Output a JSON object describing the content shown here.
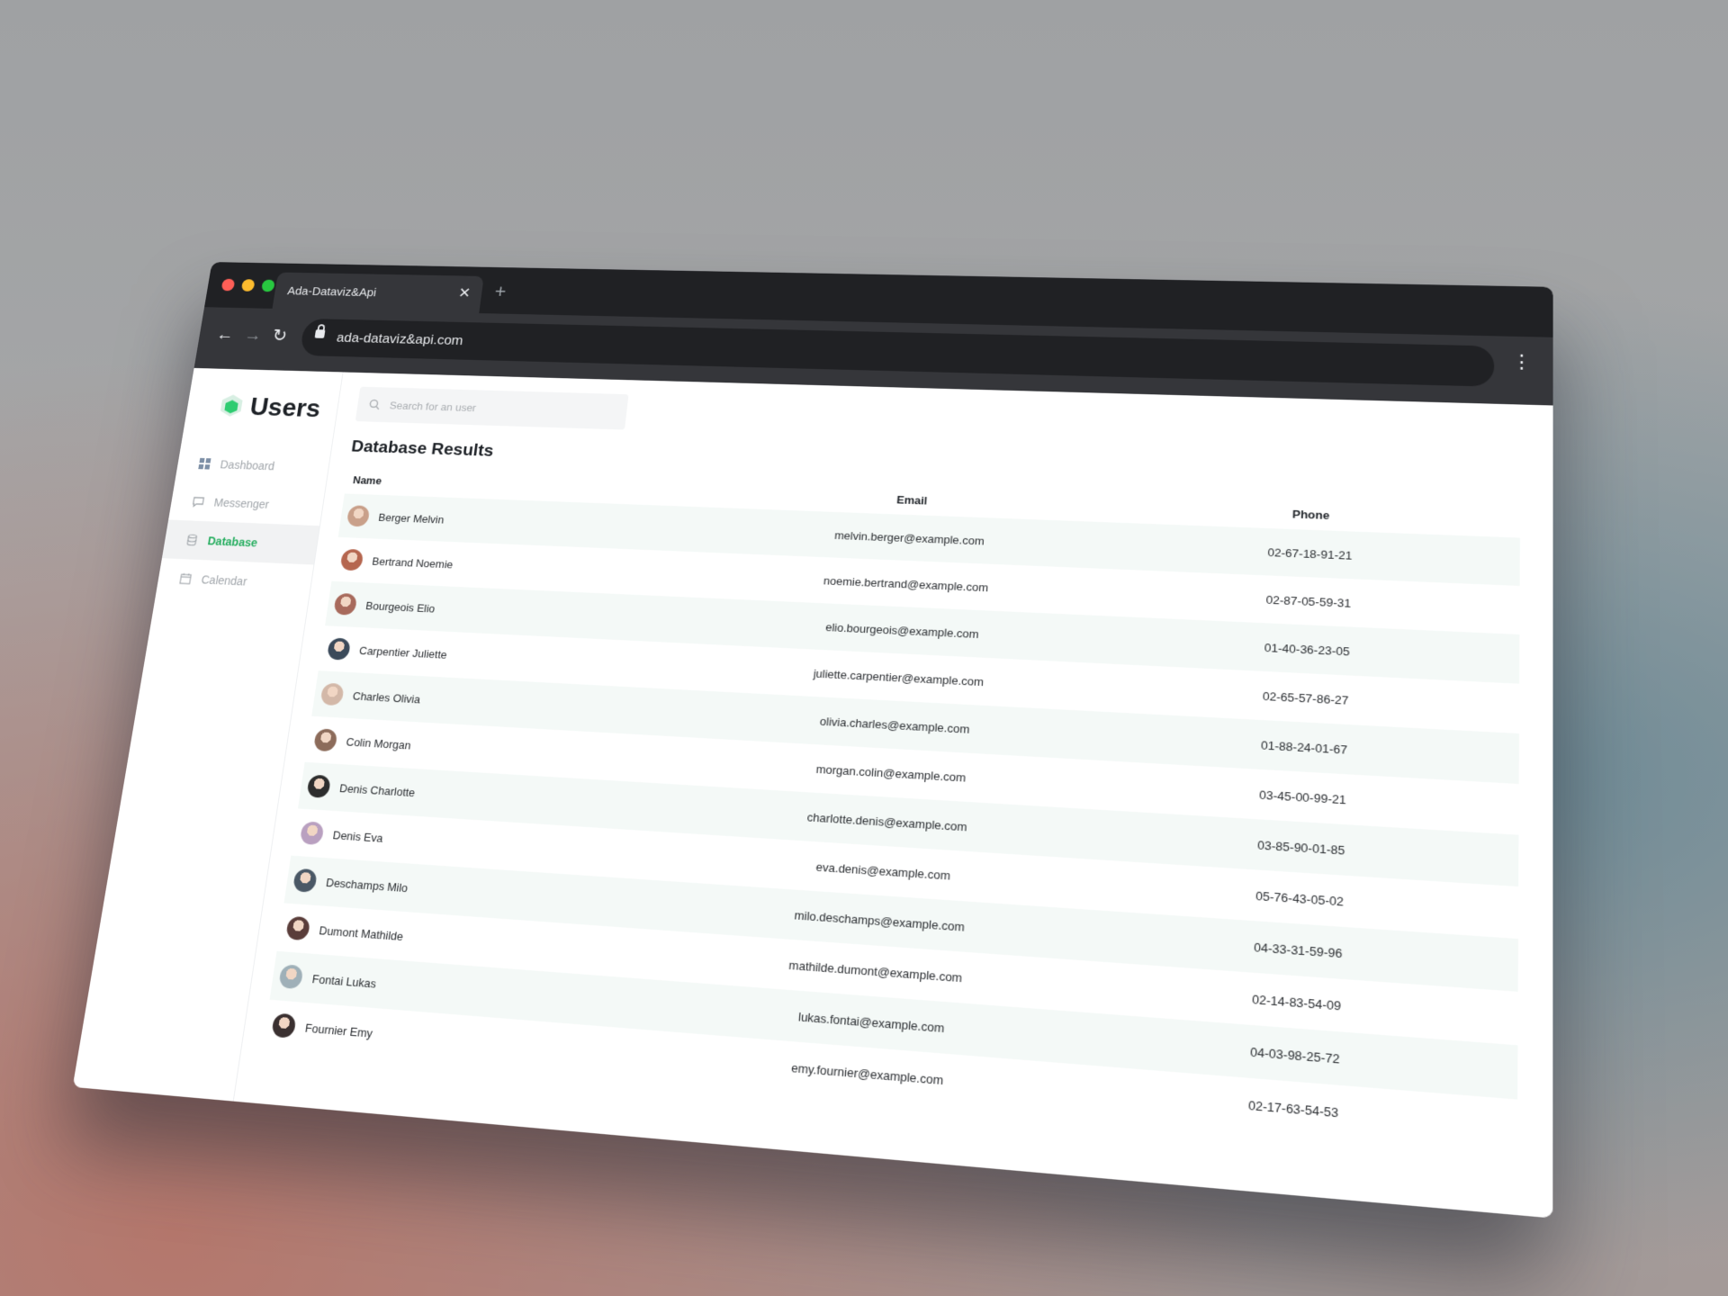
{
  "browser": {
    "tab_title": "Ada-Dataviz&Api",
    "url": "ada-dataviz&api.com",
    "traffic_lights": [
      "#ff5f57",
      "#febc2e",
      "#28c840"
    ]
  },
  "app": {
    "brand": "Users",
    "accent_color": "#27ae60",
    "nav": [
      {
        "label": "Dashboard",
        "icon": "dashboard-icon",
        "active": false
      },
      {
        "label": "Messenger",
        "icon": "chat-bubble-icon",
        "active": false
      },
      {
        "label": "Database",
        "icon": "database-icon",
        "active": true
      },
      {
        "label": "Calendar",
        "icon": "calendar-icon",
        "active": false
      }
    ],
    "search_placeholder": "Search for an user",
    "page_title": "Database Results",
    "columns": {
      "name": "Name",
      "email": "Email",
      "phone": "Phone"
    },
    "rows": [
      {
        "name": "Berger Melvin",
        "email": "melvin.berger@example.com",
        "phone": "02-67-18-91-21"
      },
      {
        "name": "Bertrand Noemie",
        "email": "noemie.bertrand@example.com",
        "phone": "02-87-05-59-31"
      },
      {
        "name": "Bourgeois Elio",
        "email": "elio.bourgeois@example.com",
        "phone": "01-40-36-23-05"
      },
      {
        "name": "Carpentier Juliette",
        "email": "juliette.carpentier@example.com",
        "phone": "02-65-57-86-27"
      },
      {
        "name": "Charles Olivia",
        "email": "olivia.charles@example.com",
        "phone": "01-88-24-01-67"
      },
      {
        "name": "Colin Morgan",
        "email": "morgan.colin@example.com",
        "phone": "03-45-00-99-21"
      },
      {
        "name": "Denis Charlotte",
        "email": "charlotte.denis@example.com",
        "phone": "03-85-90-01-85"
      },
      {
        "name": "Denis Eva",
        "email": "eva.denis@example.com",
        "phone": "05-76-43-05-02"
      },
      {
        "name": "Deschamps Milo",
        "email": "milo.deschamps@example.com",
        "phone": "04-33-31-59-96"
      },
      {
        "name": "Dumont Mathilde",
        "email": "mathilde.dumont@example.com",
        "phone": "02-14-83-54-09"
      },
      {
        "name": "Fontai Lukas",
        "email": "lukas.fontai@example.com",
        "phone": "04-03-98-25-72"
      },
      {
        "name": "Fournier Emy",
        "email": "emy.fournier@example.com",
        "phone": "02-17-63-54-53"
      }
    ]
  }
}
